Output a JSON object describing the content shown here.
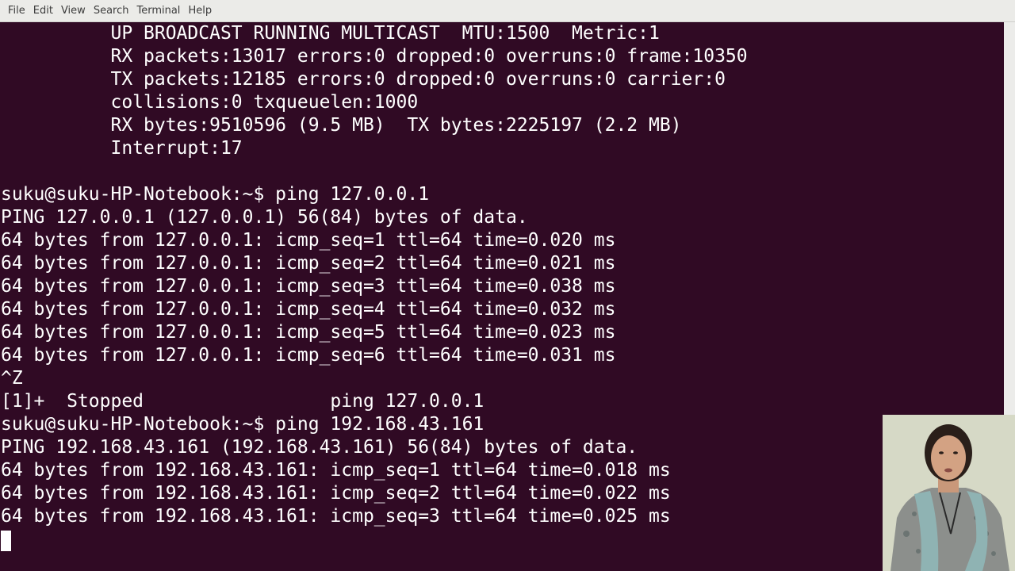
{
  "menubar": {
    "items": [
      "File",
      "Edit",
      "View",
      "Search",
      "Terminal",
      "Help"
    ]
  },
  "terminal": {
    "lines": [
      "          UP BROADCAST RUNNING MULTICAST  MTU:1500  Metric:1",
      "          RX packets:13017 errors:0 dropped:0 overruns:0 frame:10350",
      "          TX packets:12185 errors:0 dropped:0 overruns:0 carrier:0",
      "          collisions:0 txqueuelen:1000",
      "          RX bytes:9510596 (9.5 MB)  TX bytes:2225197 (2.2 MB)",
      "          Interrupt:17",
      "",
      "suku@suku-HP-Notebook:~$ ping 127.0.0.1",
      "PING 127.0.0.1 (127.0.0.1) 56(84) bytes of data.",
      "64 bytes from 127.0.0.1: icmp_seq=1 ttl=64 time=0.020 ms",
      "64 bytes from 127.0.0.1: icmp_seq=2 ttl=64 time=0.021 ms",
      "64 bytes from 127.0.0.1: icmp_seq=3 ttl=64 time=0.038 ms",
      "64 bytes from 127.0.0.1: icmp_seq=4 ttl=64 time=0.032 ms",
      "64 bytes from 127.0.0.1: icmp_seq=5 ttl=64 time=0.023 ms",
      "64 bytes from 127.0.0.1: icmp_seq=6 ttl=64 time=0.031 ms",
      "^Z",
      "[1]+  Stopped                 ping 127.0.0.1",
      "suku@suku-HP-Notebook:~$ ping 192.168.43.161",
      "PING 192.168.43.161 (192.168.43.161) 56(84) bytes of data.",
      "64 bytes from 192.168.43.161: icmp_seq=1 ttl=64 time=0.018 ms",
      "64 bytes from 192.168.43.161: icmp_seq=2 ttl=64 time=0.022 ms",
      "64 bytes from 192.168.43.161: icmp_seq=3 ttl=64 time=0.025 ms"
    ]
  },
  "colors": {
    "terminal_bg": "#300a24",
    "terminal_fg": "#ffffff",
    "menubar_bg": "#ebebe8"
  },
  "icons": {
    "cursor": "block-cursor-icon"
  }
}
